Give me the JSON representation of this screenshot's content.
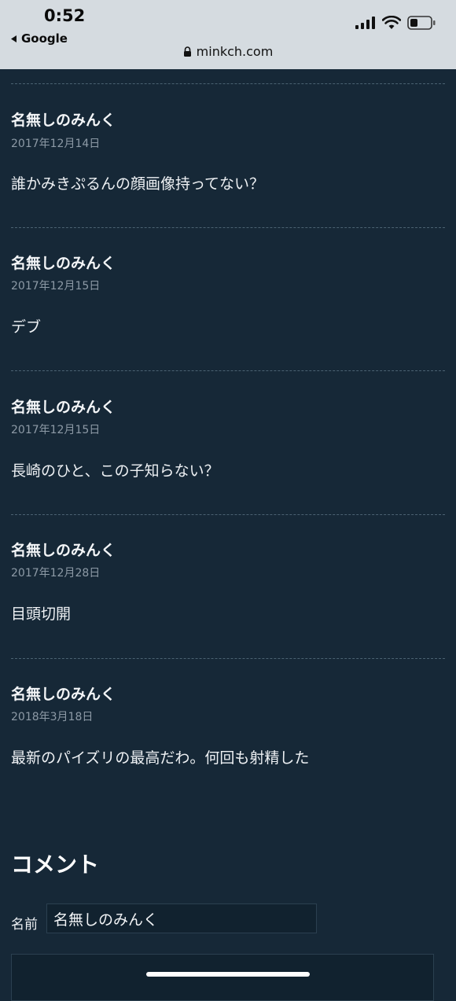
{
  "status_bar": {
    "time": "0:52",
    "back_app": "Google",
    "url": "minkch.com",
    "icons": [
      "signal-icon",
      "wifi-icon",
      "battery-icon",
      "lock-icon",
      "back-arrow-icon"
    ]
  },
  "comments": [
    {
      "author": "名無しのみんく",
      "date": "2017年12月14日",
      "body": "誰かみきぷるんの顔画像持ってない？"
    },
    {
      "author": "名無しのみんく",
      "date": "2017年12月15日",
      "body": "デブ"
    },
    {
      "author": "名無しのみんく",
      "date": "2017年12月15日",
      "body": "長崎のひと、この子知らない？"
    },
    {
      "author": "名無しのみんく",
      "date": "2017年12月28日",
      "body": "目頭切開"
    },
    {
      "author": "名無しのみんく",
      "date": "2018年3月18日",
      "body": "最新のパイズリの最高だわ。何回も射精した"
    }
  ],
  "comment_form": {
    "title": "コメント",
    "name_label": "名前",
    "name_value": "名無しのみんく"
  },
  "colors": {
    "background": "#162837",
    "status_bar": "#d5dbe0",
    "divider": "#4b6272",
    "date_text": "#8d9aa6"
  }
}
